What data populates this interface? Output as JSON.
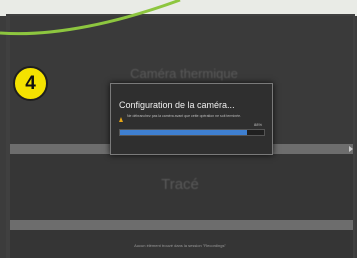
{
  "panels": {
    "upper_title": "Caméra thermique",
    "lower_title": "Tracé"
  },
  "footer": {
    "hint": "Aucun élément trouvé dans la session \"Recordings\""
  },
  "dialog": {
    "title": "Configuration de la caméra...",
    "message": "Ne débranchez pas la caméra avant que cette opération ne soit terminée.",
    "progress_percent_text": "88%",
    "progress_fraction": 0.88,
    "warning_color": "#e6a617",
    "progress_color": "#3e7fd0"
  },
  "callout": {
    "number": "4",
    "color": "#f4e200",
    "line_color": "#8dc63f"
  }
}
